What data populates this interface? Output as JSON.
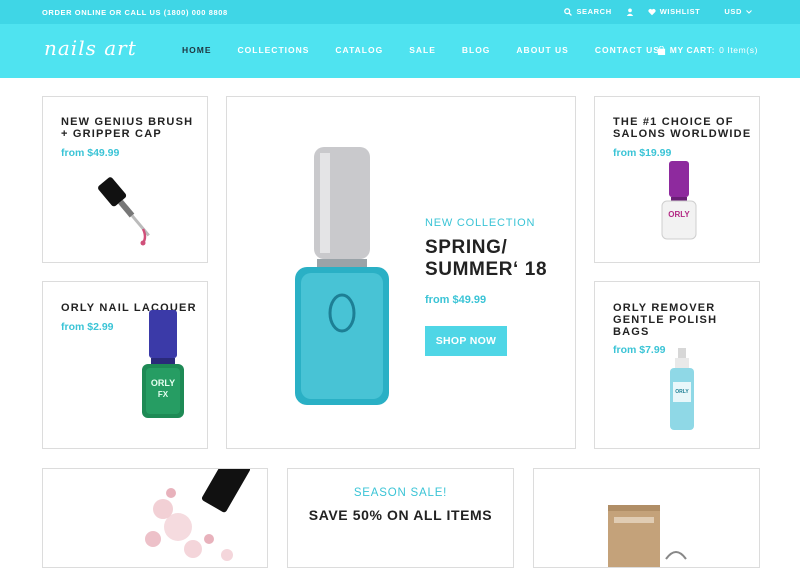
{
  "topbar": {
    "contact": "ORDER ONLINE OR CALL US (1800) 000 8808",
    "search": "SEARCH",
    "wishlist": "WISHLIST",
    "currency": "USD"
  },
  "header": {
    "logo": "nails art",
    "nav": [
      "HOME",
      "COLLECTIONS",
      "CATALOG",
      "SALE",
      "BLOG",
      "ABOUT US",
      "CONTACT US"
    ],
    "cart_label": "MY CART:",
    "cart_count": "0 Item(s)"
  },
  "products": [
    {
      "title_line1": "NEW GENIUS BRUSH",
      "title_line2": "+ GRIPPER CAP",
      "price": "from $49.99"
    },
    {
      "title_line1": "ORLY NAIL LACQUER",
      "title_line2": "",
      "price": "from $2.99"
    },
    {
      "title_line1": "THE #1 CHOICE OF",
      "title_line2": "SALONS WORLDWIDE",
      "price": "from $19.99"
    },
    {
      "title_line1": "ORLY REMOVER",
      "title_line2": "GENTLE POLISH",
      "title_line3": "BAGS",
      "price": "from $7.99"
    }
  ],
  "featured": {
    "tag": "NEW COLLECTION",
    "title_line1": "SPRING/",
    "title_line2": "SUMMER‘ 18",
    "price": "from $49.99",
    "button": "SHOP NOW"
  },
  "sale": {
    "tag": "SEASON SALE!",
    "title": "SAVE 50% ON ALL ITEMS"
  },
  "colors": {
    "accent": "#3fd6e6",
    "price": "#3bc4d6",
    "nav_active": "#1e3540"
  }
}
